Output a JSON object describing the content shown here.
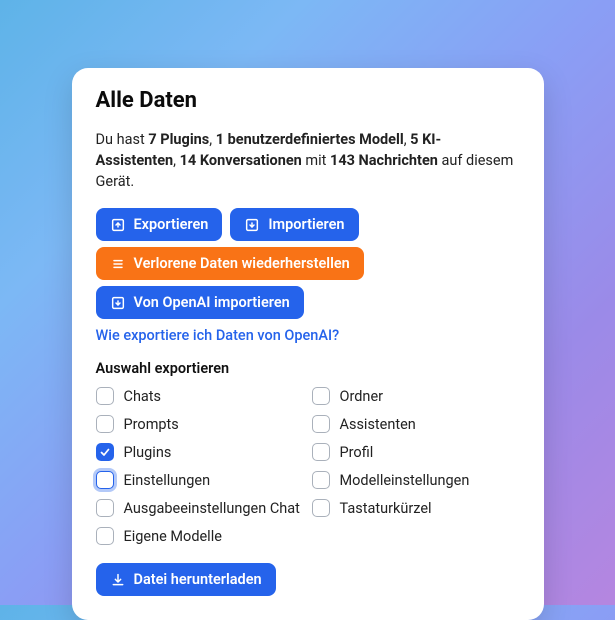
{
  "title": "Alle Daten",
  "summary": {
    "pre": "Du hast ",
    "plugins": "7 Plugins",
    "sep1": ", ",
    "models": "1 benutzerdefiniertes Modell",
    "sep2": ", ",
    "assistants": "5 KI-Assistenten",
    "sep3": ", ",
    "conversations": "14 Konversationen",
    "mit": " mit ",
    "messages": "143 Nachrichten",
    "post": " auf diesem Gerät."
  },
  "buttons": {
    "export": "Exportieren",
    "import": "Importieren",
    "recover": "Verlorene Daten wiederherstellen",
    "fromOpenAI": "Von OpenAI importieren",
    "openAIHelp": "Wie exportiere ich Daten von OpenAI?",
    "download": "Datei herunterladen"
  },
  "selectionLabel": "Auswahl exportieren",
  "options": {
    "left": [
      {
        "label": "Chats",
        "checked": false,
        "focused": false
      },
      {
        "label": "Prompts",
        "checked": false,
        "focused": false
      },
      {
        "label": "Plugins",
        "checked": true,
        "focused": false
      },
      {
        "label": "Einstellungen",
        "checked": false,
        "focused": true
      },
      {
        "label": "Ausgabeeinstellungen Chat",
        "checked": false,
        "focused": false
      },
      {
        "label": "Eigene Modelle",
        "checked": false,
        "focused": false
      }
    ],
    "right": [
      {
        "label": "Ordner",
        "checked": false,
        "focused": false
      },
      {
        "label": "Assistenten",
        "checked": false,
        "focused": false
      },
      {
        "label": "Profil",
        "checked": false,
        "focused": false
      },
      {
        "label": "Modelleinstellungen",
        "checked": false,
        "focused": false
      },
      {
        "label": "Tastaturkürzel",
        "checked": false,
        "focused": false
      }
    ]
  }
}
